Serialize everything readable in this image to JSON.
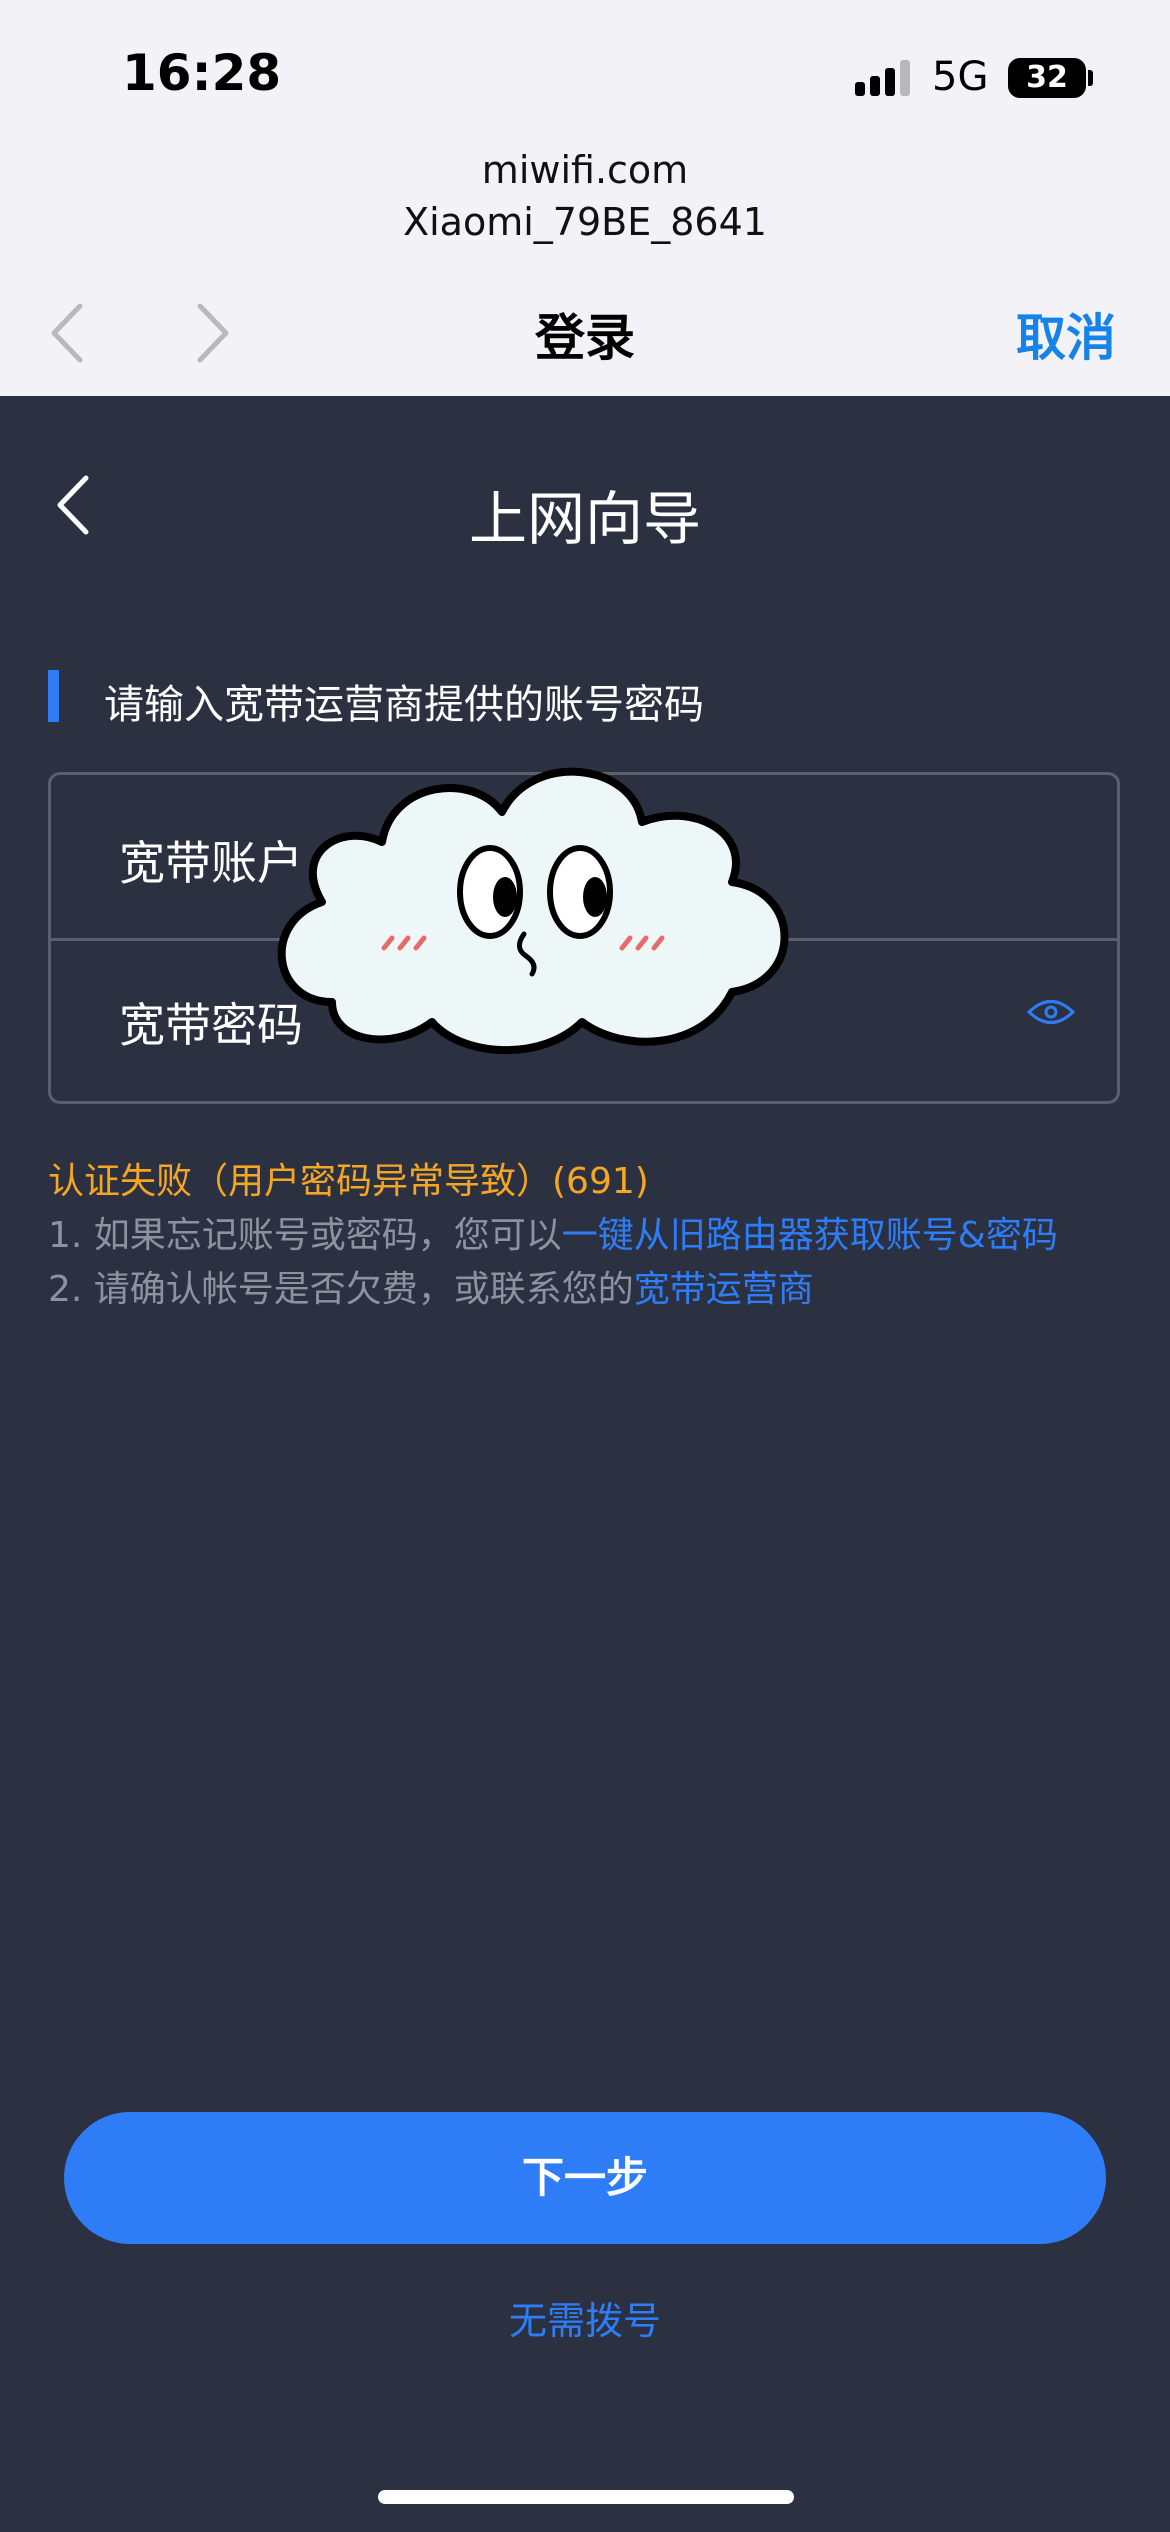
{
  "status": {
    "time": "16:28",
    "network": "5G",
    "battery": "32"
  },
  "browser": {
    "domain": "miwifi.com",
    "ssid": "Xiaomi_79BE_8641",
    "title": "登录",
    "cancel": "取消"
  },
  "header": {
    "title": "上网向导"
  },
  "section": {
    "label": "请输入宽带运营商提供的账号密码"
  },
  "form": {
    "account_label": "宽带账户",
    "password_label": "宽带密码"
  },
  "error": {
    "message": "认证失败（用户密码异常导致）(691)"
  },
  "tips": {
    "line1_prefix": "1. 如果忘记账号或密码，您可以",
    "line1_link": "一键从旧路由器获取账号&密码",
    "line2_prefix": "2. 请确认帐号是否欠费，或联系您的",
    "line2_link": "宽带运营商"
  },
  "actions": {
    "next": "下一步",
    "skip": "无需拨号"
  },
  "colors": {
    "accent": "#2e7df6",
    "warning": "#f5a623",
    "background": "#2c3142"
  }
}
